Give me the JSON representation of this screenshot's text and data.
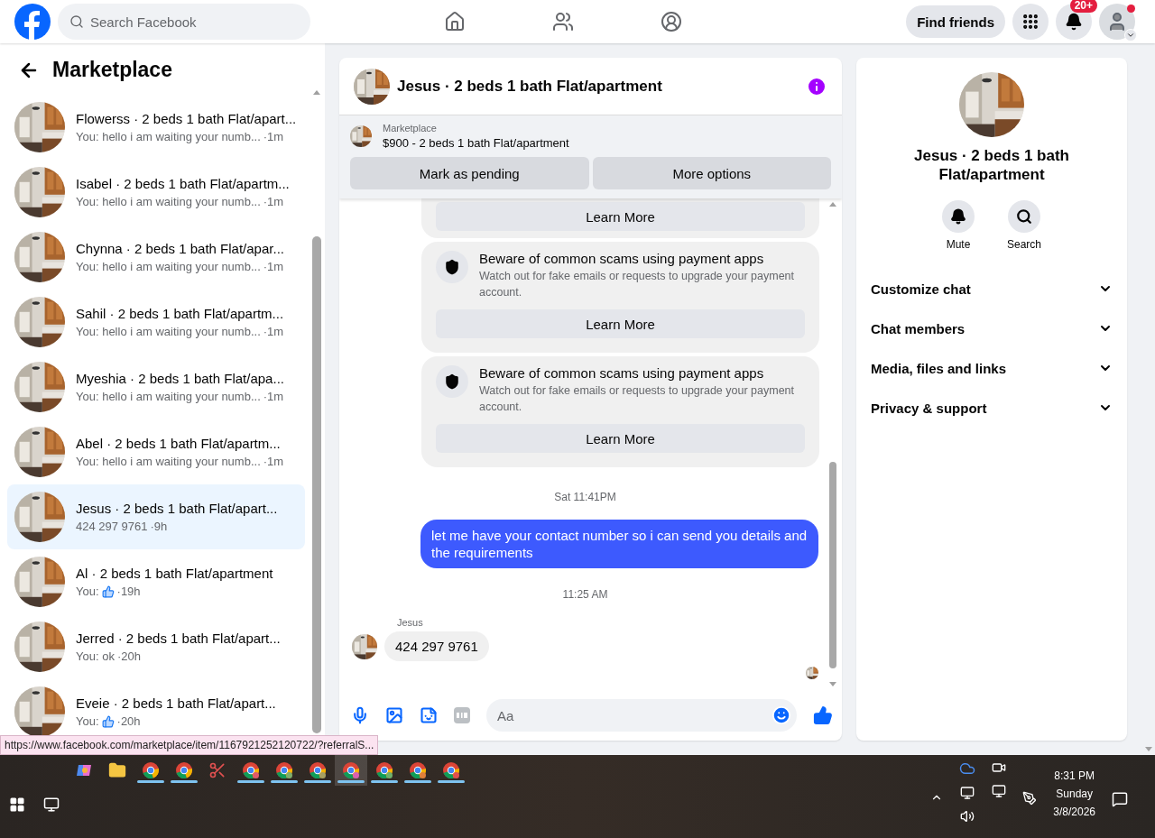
{
  "topbar": {
    "search": {
      "placeholder": "Search Facebook"
    },
    "nav": [
      {
        "kind": "home",
        "selected": false
      },
      {
        "kind": "friends",
        "selected": false
      },
      {
        "kind": "groups",
        "selected": false
      }
    ],
    "find_friends": "Find friends",
    "notifications_badge": "20+"
  },
  "sidebar": {
    "title": "Marketplace",
    "conversations": [
      {
        "title": "Flowerss · 2 beds 1 bath Flat/apart...",
        "kind": "text",
        "preview": "You: hello i am waiting your numb...",
        "time": "·1m",
        "selected": false
      },
      {
        "title": "Isabel · 2 beds 1 bath Flat/apartm...",
        "kind": "text",
        "preview": "You: hello i am waiting your numb...",
        "time": "·1m",
        "selected": false
      },
      {
        "title": "Chynna · 2 beds 1 bath Flat/apar...",
        "kind": "text",
        "preview": "You: hello i am waiting your numb...",
        "time": "·1m",
        "selected": false
      },
      {
        "title": "Sahil · 2 beds 1 bath Flat/apartm...",
        "kind": "text",
        "preview": "You: hello i am waiting your numb...",
        "time": "·1m",
        "selected": false
      },
      {
        "title": "Myeshia · 2 beds 1 bath Flat/apa...",
        "kind": "text",
        "preview": "You: hello i am waiting your numb...",
        "time": "·1m",
        "selected": false
      },
      {
        "title": "Abel · 2 beds 1 bath Flat/apartm...",
        "kind": "text",
        "preview": "You: hello i am waiting your numb...",
        "time": "·1m",
        "selected": false
      },
      {
        "title": "Jesus · 2 beds 1 bath Flat/apart...",
        "kind": "text",
        "preview": "424 297 9761",
        "time": "·9h",
        "selected": true
      },
      {
        "title": "Al · 2 beds 1 bath Flat/apartment",
        "kind": "like",
        "preview": "You:",
        "time": "·19h",
        "selected": false
      },
      {
        "title": "Jerred · 2 beds 1 bath Flat/apart...",
        "kind": "text",
        "preview": "You: ok",
        "time": "·20h",
        "selected": false
      },
      {
        "title": "Eveie · 2 beds 1 bath Flat/apart...",
        "kind": "like",
        "preview": "You:",
        "time": "·20h",
        "selected": false
      }
    ]
  },
  "chat": {
    "title": "Jesus · 2 beds 1 bath Flat/apartment",
    "listing": {
      "label": "Marketplace",
      "summary": "$900 - 2 beds 1 bath Flat/apartment",
      "buttons": [
        "Mark as pending",
        "More options"
      ]
    },
    "messages": [
      {
        "kind": "notice_tail",
        "button": "Learn More"
      },
      {
        "kind": "notice",
        "title": "Beware of common scams using payment apps",
        "body": "Watch out for fake emails or requests to upgrade your payment account.",
        "button": "Learn More"
      },
      {
        "kind": "notice",
        "title": "Beware of common scams using payment apps",
        "body": "Watch out for fake emails or requests to upgrade your payment account.",
        "button": "Learn More"
      },
      {
        "kind": "timestamp",
        "text": "Sat 11:41PM"
      },
      {
        "kind": "outgoing",
        "text": "let me have your contact number so i can send you details and the requirements"
      },
      {
        "kind": "timestamp",
        "text": "11:25 AM"
      },
      {
        "kind": "incoming",
        "sender": "Jesus",
        "text": "424 297 9761"
      }
    ],
    "composer": {
      "placeholder": "Aa"
    }
  },
  "details": {
    "title": "Jesus · 2 beds 1 bath Flat/apartment",
    "actions": [
      {
        "kind": "mute",
        "label": "Mute"
      },
      {
        "kind": "search",
        "label": "Search"
      }
    ],
    "sections": [
      {
        "label": "Customize chat",
        "expanded": false
      },
      {
        "label": "Chat members",
        "expanded": false
      },
      {
        "label": "Media, files and links",
        "expanded": false
      },
      {
        "label": "Privacy & support",
        "expanded": false
      }
    ]
  },
  "status_url": "https://www.facebook.com/marketplace/item/1167921252120722/?referralS...",
  "taskbar": {
    "apps": [
      {
        "kind": "copilot",
        "running": false,
        "selected": false
      },
      {
        "kind": "files",
        "running": false,
        "selected": false
      },
      {
        "kind": "browser",
        "running": true,
        "selected": false
      },
      {
        "kind": "browser",
        "running": true,
        "selected": false
      },
      {
        "kind": "snipping",
        "running": false,
        "selected": false
      },
      {
        "kind": "profile",
        "color": "#e05a6a",
        "running": true,
        "selected": false
      },
      {
        "kind": "profile",
        "color": "#7fae6a",
        "running": true,
        "selected": false
      },
      {
        "kind": "profile",
        "color": "#a8a060",
        "running": true,
        "selected": false
      },
      {
        "kind": "profile",
        "color": "#d960b0",
        "running": true,
        "selected": true
      },
      {
        "kind": "profile",
        "color": "#6fb06a",
        "running": true,
        "selected": false
      },
      {
        "kind": "profile",
        "color": "#e0803a",
        "running": true,
        "selected": false
      },
      {
        "kind": "profile",
        "color": "#e05050",
        "running": true,
        "selected": false
      }
    ],
    "clock": {
      "time": "8:31 PM",
      "day": "Sunday",
      "date": "3/8/2026"
    }
  }
}
